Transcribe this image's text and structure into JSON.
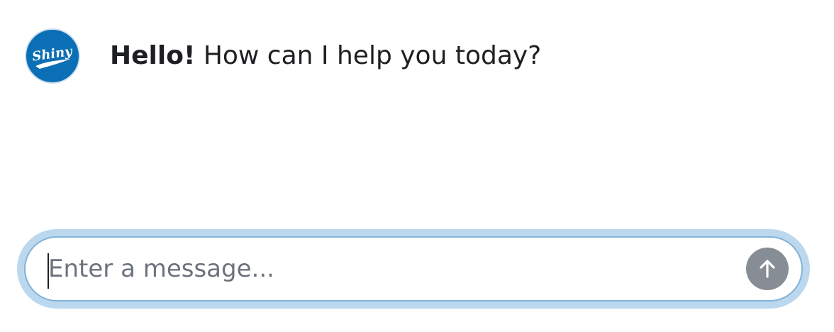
{
  "message": {
    "bold_text": "Hello!",
    "text": " How can I help you today?"
  },
  "avatar": {
    "logo_text": "Shiny",
    "color": "#0b6fb6"
  },
  "composer": {
    "placeholder": "Enter a message...",
    "value": "",
    "send_icon": "arrow-up-icon",
    "send_button_color": "#878d95",
    "focus_ring_color": "#bcd8ee"
  }
}
